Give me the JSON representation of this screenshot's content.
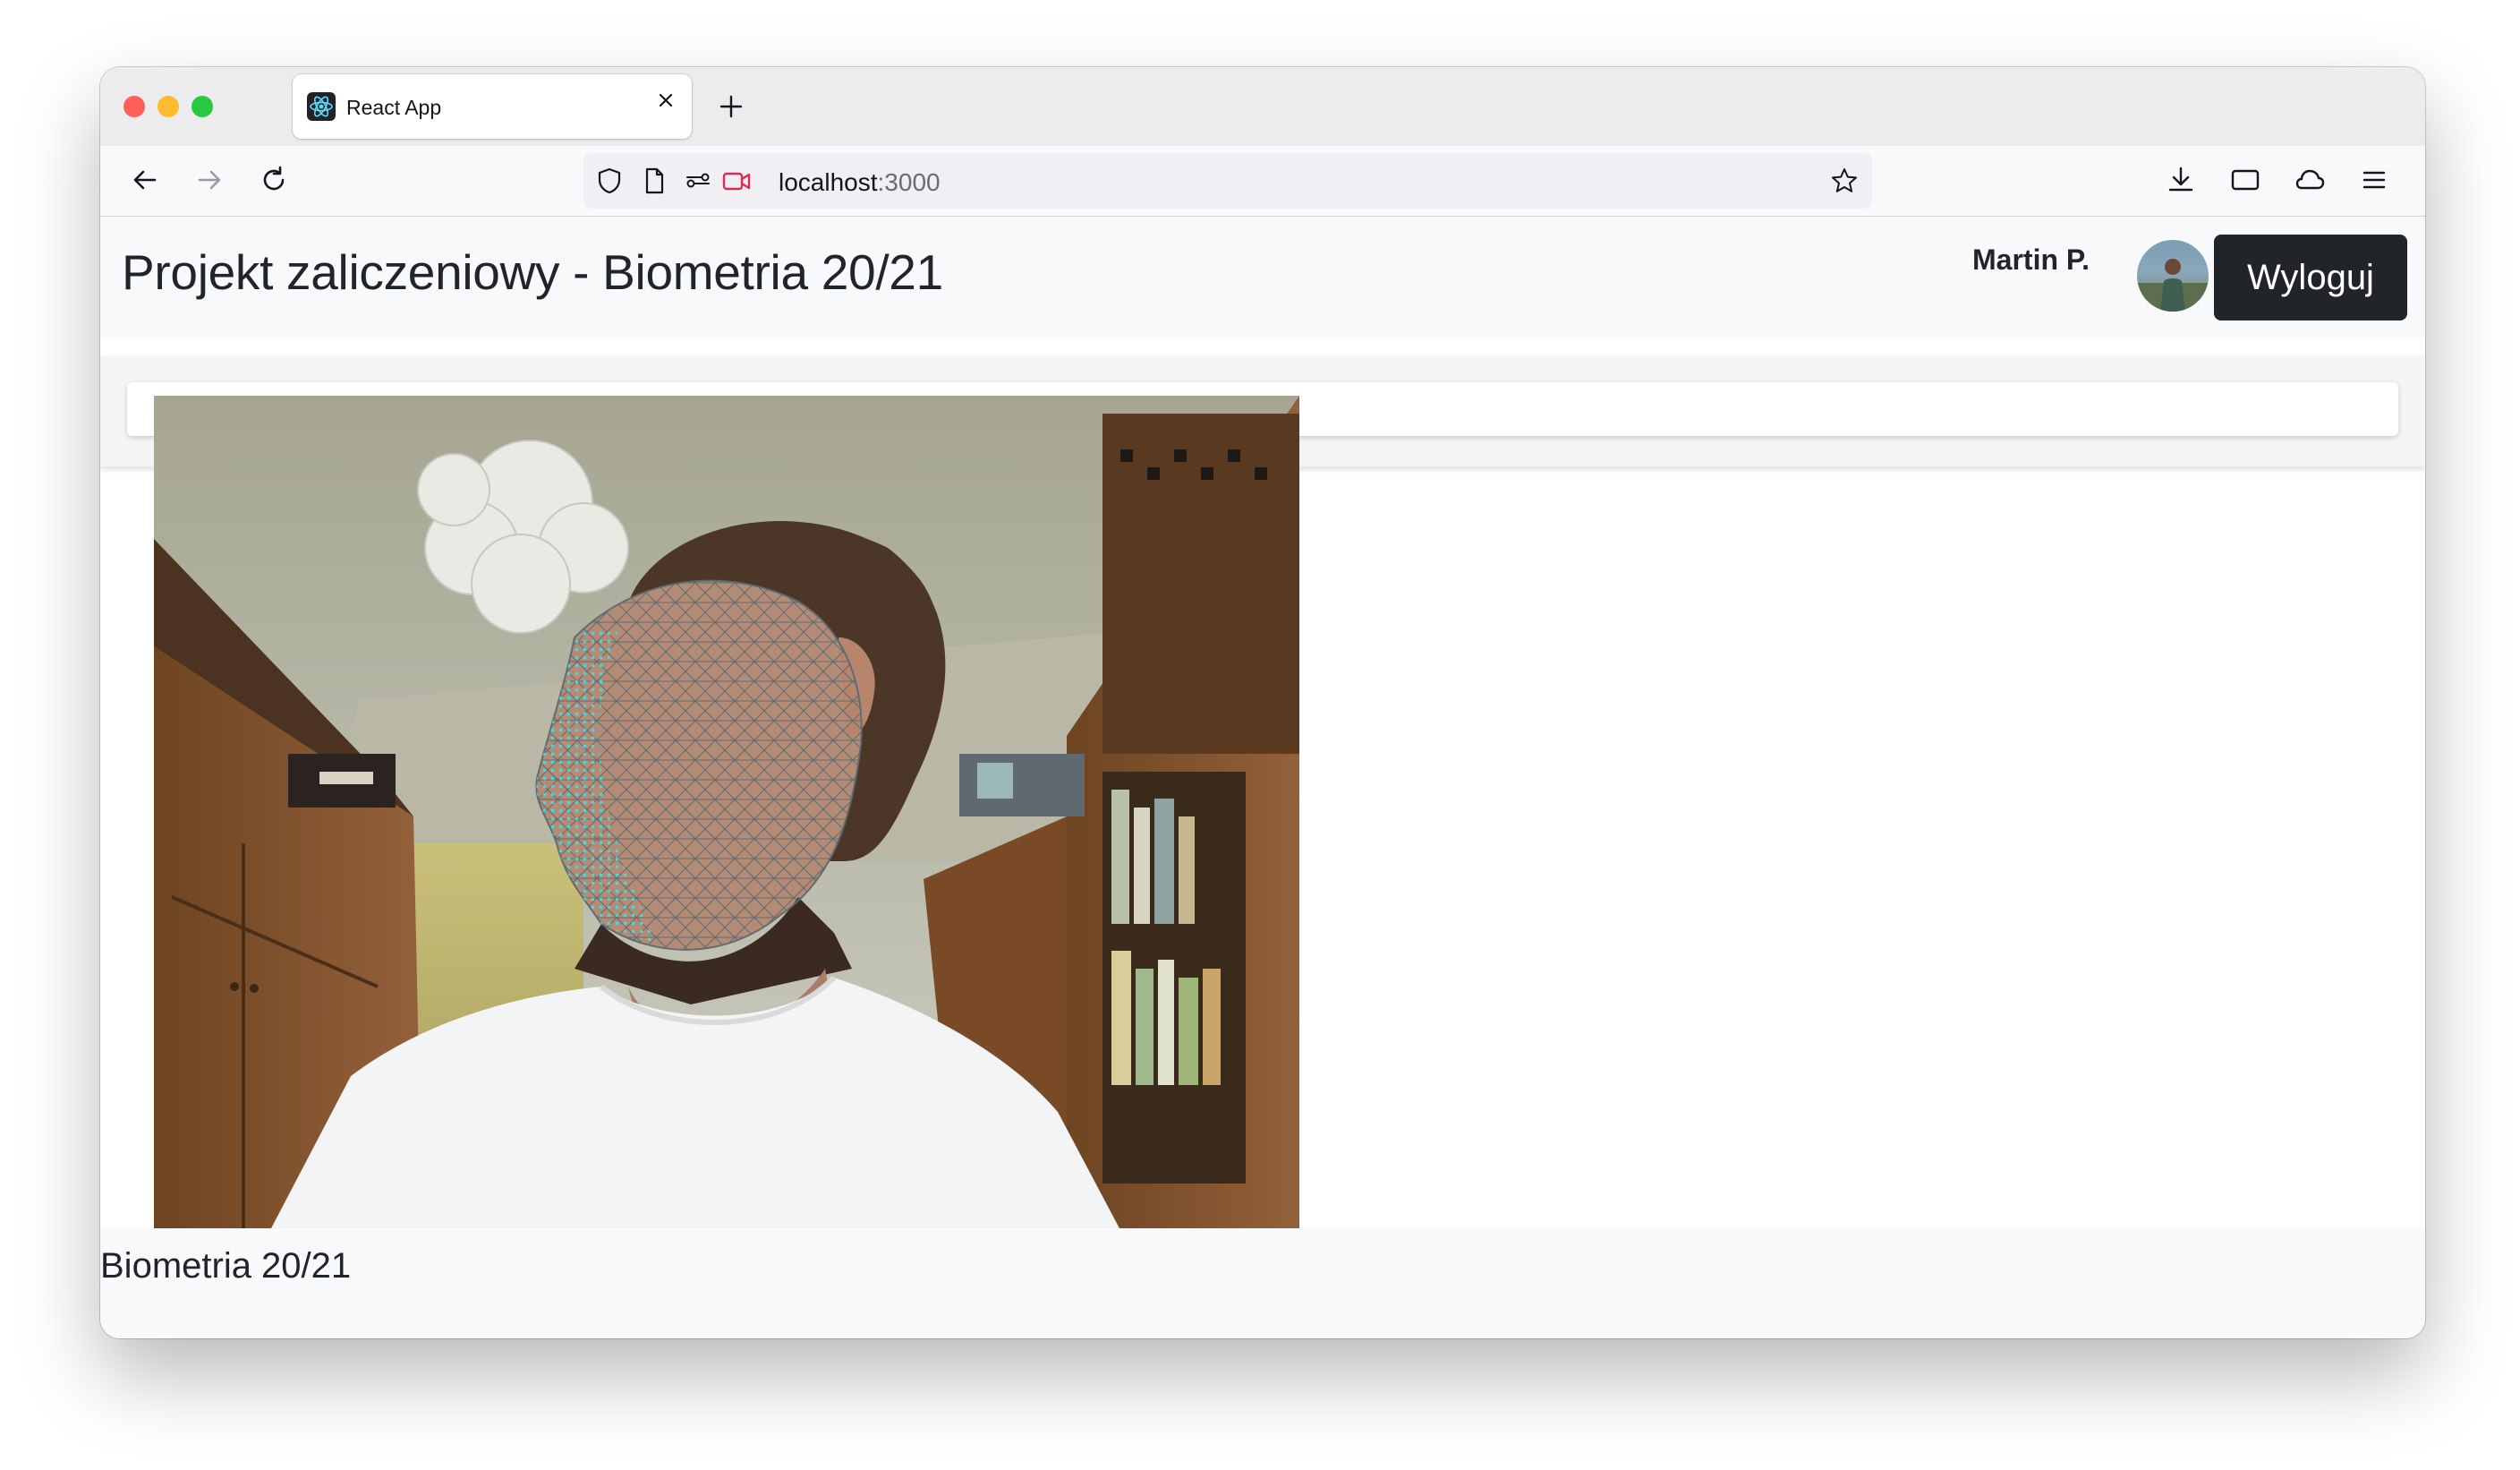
{
  "browser": {
    "tab_title": "React App",
    "url_host": "localhost",
    "url_port": ":3000"
  },
  "header": {
    "title": "Projekt zaliczeniowy - Biometria 20/21",
    "username": "Martin P.",
    "logout_label": "Wyloguj"
  },
  "footer": {
    "text": "Biometria 20/21"
  },
  "icons": {
    "tab": [
      "react-favicon",
      "close-icon",
      "plus-icon"
    ],
    "nav": [
      "back-arrow-icon",
      "forward-arrow-icon",
      "reload-icon",
      "shield-icon",
      "page-icon",
      "permissions-icon",
      "camera-sharing-icon",
      "star-icon",
      "download-icon",
      "window-icon",
      "cloud-icon",
      "menu-icon"
    ]
  },
  "colors": {
    "header_bg": "#f8f9fa",
    "logout_bg": "#212529",
    "mesh": "#3ee0e6"
  }
}
